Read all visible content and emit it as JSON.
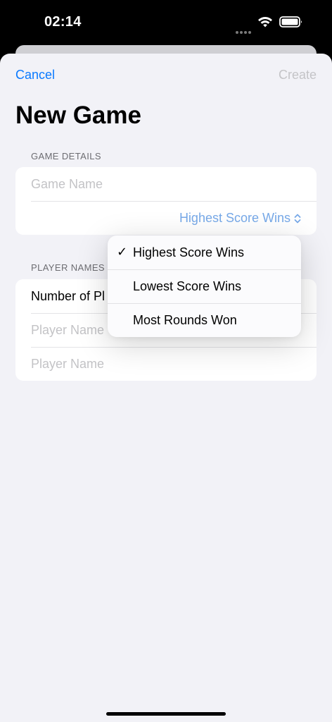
{
  "status": {
    "time": "02:14"
  },
  "nav": {
    "cancel": "Cancel",
    "create": "Create"
  },
  "title": "New Game",
  "game_details": {
    "header": "GAME DETAILS",
    "name_placeholder": "Game Name",
    "scoring_value": "Highest Score Wins"
  },
  "players": {
    "header": "PLAYER NAMES",
    "count_label": "Number of Pl",
    "player_placeholders": [
      "Player Name",
      "Player Name"
    ]
  },
  "menu": {
    "check": "✓",
    "options": [
      "Highest Score Wins",
      "Lowest Score Wins",
      "Most Rounds Won"
    ]
  },
  "colors": {
    "accent": "#0a7aff",
    "disabled": "#c4c4c7",
    "background": "#f2f2f7"
  }
}
